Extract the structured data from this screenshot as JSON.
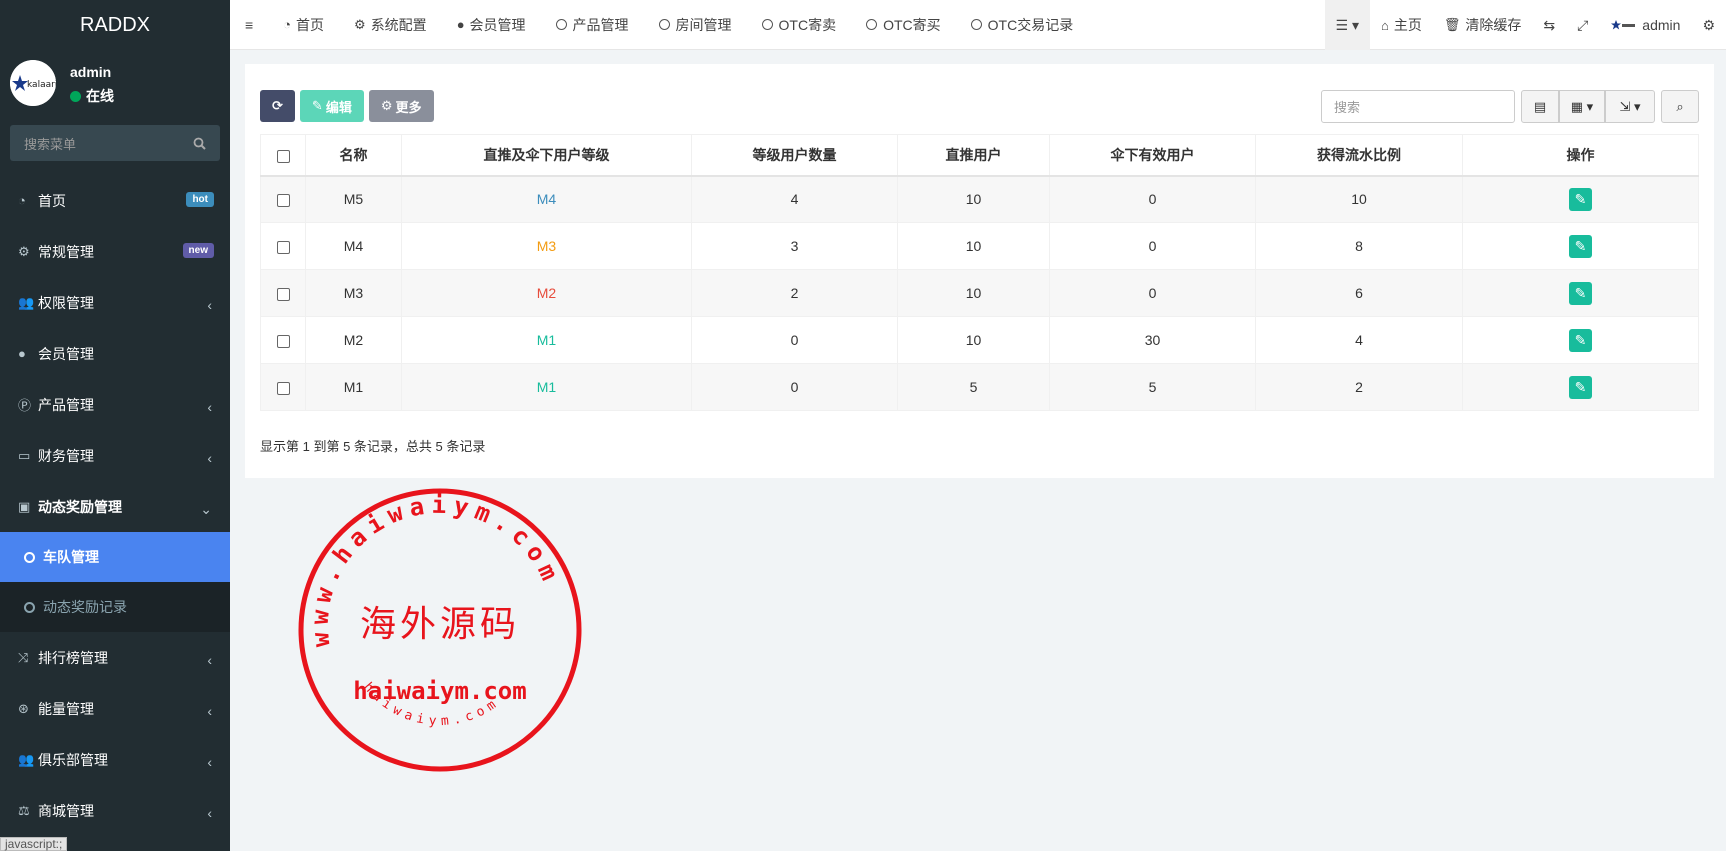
{
  "sidebar": {
    "logo": "RADDX",
    "user": {
      "name": "admin",
      "status": "在线"
    },
    "search_placeholder": "搜索菜单",
    "items": [
      {
        "label": "首页",
        "icon": "dashboard-icon",
        "badge": "hot",
        "badge_color": "#3c8dbc"
      },
      {
        "label": "常规管理",
        "icon": "cogs-icon",
        "badge": "new",
        "badge_color": "#605ca8"
      },
      {
        "label": "权限管理",
        "icon": "group-icon"
      },
      {
        "label": "会员管理",
        "icon": "user-icon"
      },
      {
        "label": "产品管理",
        "icon": "product-icon"
      },
      {
        "label": "财务管理",
        "icon": "credit-card-icon"
      },
      {
        "label": "动态奖励管理",
        "icon": "reward-icon"
      },
      {
        "label": "排行榜管理",
        "icon": "random-icon"
      },
      {
        "label": "能量管理",
        "icon": "energy-icon"
      },
      {
        "label": "俱乐部管理",
        "icon": "club-icon"
      },
      {
        "label": "商城管理",
        "icon": "balance-icon"
      }
    ],
    "subitems": [
      {
        "label": "车队管理"
      },
      {
        "label": "动态奖励记录"
      }
    ]
  },
  "topbar": {
    "nav": [
      "首页",
      "系统配置",
      "会员管理",
      "产品管理",
      "房间管理",
      "OTC寄卖",
      "OTC寄买",
      "OTC交易记录"
    ],
    "right": {
      "home": "主页",
      "clear_cache": "清除缓存",
      "user": "admin"
    }
  },
  "toolbar": {
    "edit": "编辑",
    "more": "更多",
    "search_placeholder": "搜索"
  },
  "table": {
    "headers": [
      "名称",
      "直推及伞下用户等级",
      "等级用户数量",
      "直推用户",
      "伞下有效用户",
      "获得流水比例",
      "操作"
    ],
    "rows": [
      {
        "name": "M5",
        "level": "M4",
        "level_color": "#3c8dbc",
        "count": "4",
        "direct": "10",
        "valid": "0",
        "ratio": "10"
      },
      {
        "name": "M4",
        "level": "M3",
        "level_color": "#f39c12",
        "count": "3",
        "direct": "10",
        "valid": "0",
        "ratio": "8"
      },
      {
        "name": "M3",
        "level": "M2",
        "level_color": "#e74c3c",
        "count": "2",
        "direct": "10",
        "valid": "0",
        "ratio": "6"
      },
      {
        "name": "M2",
        "level": "M1",
        "level_color": "#18bc9c",
        "count": "0",
        "direct": "10",
        "valid": "30",
        "ratio": "4"
      },
      {
        "name": "M1",
        "level": "M1",
        "level_color": "#18bc9c",
        "count": "0",
        "direct": "5",
        "valid": "5",
        "ratio": "2"
      }
    ]
  },
  "pagination_info": "显示第 1 到第 5 条记录，总共 5 条记录",
  "watermark": {
    "top_arc": "www.haiwaiym.com",
    "center": "海外源码",
    "domain": "haiwaiym.com",
    "bottom_arc": "haiwaiym.com"
  },
  "statusbar": "javascript:;"
}
